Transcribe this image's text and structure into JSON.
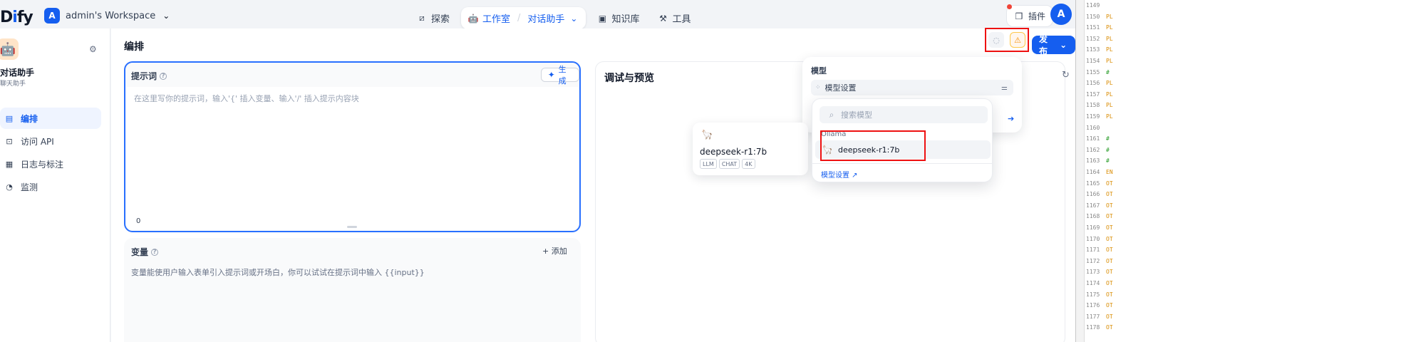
{
  "brand": {
    "logo_prefix": "D",
    "logo_highlight": "i",
    "logo_suffix": "fy"
  },
  "workspace": {
    "avatar_letter": "A",
    "name": "admin's Workspace"
  },
  "nav": {
    "explore": "探索",
    "studio": "工作室",
    "studio_sub": "对话助手",
    "knowledge": "知识库",
    "tools": "工具",
    "plugins": "插件",
    "user_letter": "A"
  },
  "sidebar": {
    "app_name": "对话助手",
    "app_type": "聊天助手",
    "items": [
      {
        "label": "编排",
        "icon": "layout-icon"
      },
      {
        "label": "访问 API",
        "icon": "terminal-icon"
      },
      {
        "label": "日志与标注",
        "icon": "document-icon"
      },
      {
        "label": "监测",
        "icon": "gauge-icon"
      }
    ]
  },
  "main": {
    "title": "编排",
    "publish_label": "发布",
    "prompt": {
      "title": "提示词",
      "generate_label": "生成",
      "placeholder": "在这里写你的提示词，输入'{' 插入变量、输入'/' 插入提示内容块",
      "char_count": "0"
    },
    "variables": {
      "title": "变量",
      "add_label": "添加",
      "description": "变量能使用户输入表单引入提示词或开场白，你可以试试在提示词中输入 {{input}}"
    },
    "preview": {
      "title": "调试与预览"
    }
  },
  "model_panel": {
    "label": "模型",
    "select_label": "模型设置"
  },
  "model_dropdown": {
    "search_placeholder": "搜索模型",
    "provider": "Ollama",
    "item": "deepseek-r1:7b",
    "footer_link": "模型设置 ↗"
  },
  "model_card": {
    "name": "deepseek-r1:7b",
    "tags": [
      "LLM",
      "CHAT",
      "4K"
    ]
  },
  "code_gutter": {
    "lines": [
      {
        "n": "1149",
        "t": ""
      },
      {
        "n": "1150",
        "t": "PL"
      },
      {
        "n": "1151",
        "t": "PL"
      },
      {
        "n": "1152",
        "t": "PL"
      },
      {
        "n": "1153",
        "t": "PL"
      },
      {
        "n": "1154",
        "t": "PL"
      },
      {
        "n": "1155",
        "t": "#"
      },
      {
        "n": "1156",
        "t": "PL"
      },
      {
        "n": "1157",
        "t": "PL"
      },
      {
        "n": "1158",
        "t": "PL"
      },
      {
        "n": "1159",
        "t": "PL"
      },
      {
        "n": "1160",
        "t": ""
      },
      {
        "n": "1161",
        "t": "#"
      },
      {
        "n": "1162",
        "t": "#"
      },
      {
        "n": "1163",
        "t": "#"
      },
      {
        "n": "1164",
        "t": "EN"
      },
      {
        "n": "1165",
        "t": "OT"
      },
      {
        "n": "1166",
        "t": "OT"
      },
      {
        "n": "1167",
        "t": "OT"
      },
      {
        "n": "1168",
        "t": "OT"
      },
      {
        "n": "1169",
        "t": "OT"
      },
      {
        "n": "1170",
        "t": "OT"
      },
      {
        "n": "1171",
        "t": "OT"
      },
      {
        "n": "1172",
        "t": "OT"
      },
      {
        "n": "1173",
        "t": "OT"
      },
      {
        "n": "1174",
        "t": "OT"
      },
      {
        "n": "1175",
        "t": "OT"
      },
      {
        "n": "1176",
        "t": "OT"
      },
      {
        "n": "1177",
        "t": "OT"
      },
      {
        "n": "1178",
        "t": "OT"
      }
    ],
    "colors": {
      "PL": "#d98b00",
      "#": "#2a9d2a",
      "EN": "#d98b00",
      "OT": "#d98b00"
    }
  },
  "colors": {
    "accent": "#155eef",
    "highlight_box": "#ee1111",
    "warning": "#f79009"
  }
}
